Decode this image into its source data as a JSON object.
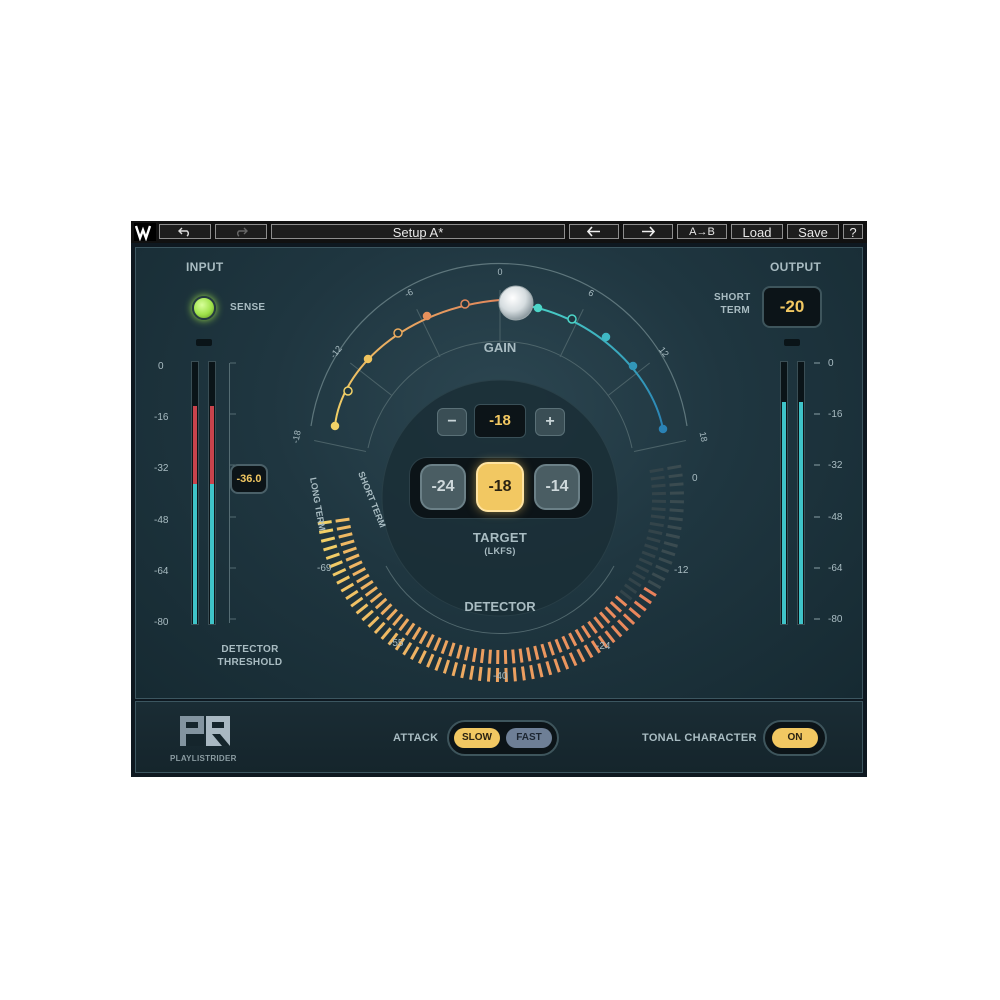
{
  "toolbar": {
    "undo_icon": "undo-icon",
    "redo_icon": "redo-icon",
    "setup_name": "Setup A*",
    "prev_icon": "arrow-left-icon",
    "next_icon": "arrow-right-icon",
    "ab_label": "A→B",
    "load_label": "Load",
    "save_label": "Save",
    "help_label": "?"
  },
  "input": {
    "title": "INPUT",
    "sense_label": "SENSE",
    "sense_led_color": "#9fe24a",
    "scale": [
      "0",
      "-16",
      "-32",
      "-48",
      "-64",
      "-80"
    ],
    "threshold_value": "-36.0",
    "threshold_label_1": "DETECTOR",
    "threshold_label_2": "THRESHOLD"
  },
  "output": {
    "title": "OUTPUT",
    "short_term_1": "SHORT",
    "short_term_2": "TERM",
    "value": "-20",
    "scale": [
      "0",
      "-16",
      "-32",
      "-48",
      "-64",
      "-80"
    ]
  },
  "gain": {
    "label": "GAIN",
    "ticks": [
      "-18",
      "-12",
      "-6",
      "0",
      "6",
      "12",
      "18"
    ],
    "value_display": "-18",
    "minus_label": "−",
    "plus_label": "+"
  },
  "target": {
    "options": [
      "-24",
      "-18",
      "-14"
    ],
    "selected": "-18",
    "label": "TARGET",
    "unit": "(LKFS)"
  },
  "detector": {
    "label": "DETECTOR",
    "short_term": "SHORT TERM",
    "long_term": "LONG TERM",
    "scale": [
      "0",
      "-12",
      "-24",
      "-40",
      "-55",
      "-69"
    ]
  },
  "bottom": {
    "logo_text": "PLAYLISTRIDER",
    "attack_label": "ATTACK",
    "attack_slow": "SLOW",
    "attack_fast": "FAST",
    "attack_selected": "SLOW",
    "tonal_label": "TONAL CHARACTER",
    "tonal_value": "ON"
  },
  "colors": {
    "accent_yellow": "#f2c862",
    "accent_orange": "#e8895a",
    "accent_cyan": "#3fc3c8",
    "meter_red": "#c8434c"
  }
}
